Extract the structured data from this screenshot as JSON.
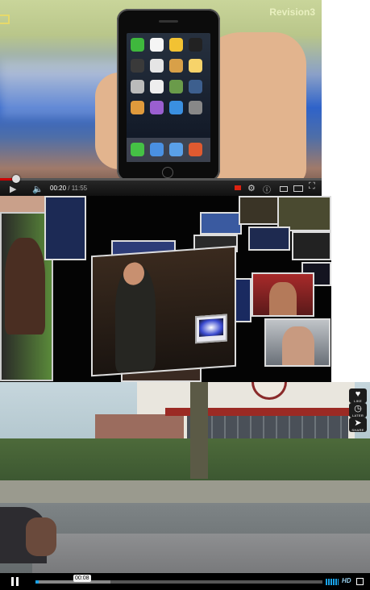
{
  "player1": {
    "brand_logo": "Revision3",
    "current_time": "00:20",
    "separator": " / ",
    "duration": "11:55",
    "progress_fraction": 0.04,
    "accent": "#cc0000",
    "icons": [
      "play-icon",
      "volume-icon",
      "record-icon",
      "settings-icon",
      "info-icon",
      "small-player-icon",
      "large-player-icon",
      "fullscreen-icon"
    ]
  },
  "player2": {
    "icons": []
  },
  "player3": {
    "side_buttons": [
      {
        "icon": "heart-icon",
        "label": "LIKE"
      },
      {
        "icon": "clock-icon",
        "label": "LATER"
      },
      {
        "icon": "share-icon",
        "label": "SHARE"
      }
    ],
    "current_time": "00:08",
    "progress_fraction": 0.01,
    "buffer_fraction": 0.26,
    "hd_label": "HD",
    "accent": "#1aa3e8"
  }
}
